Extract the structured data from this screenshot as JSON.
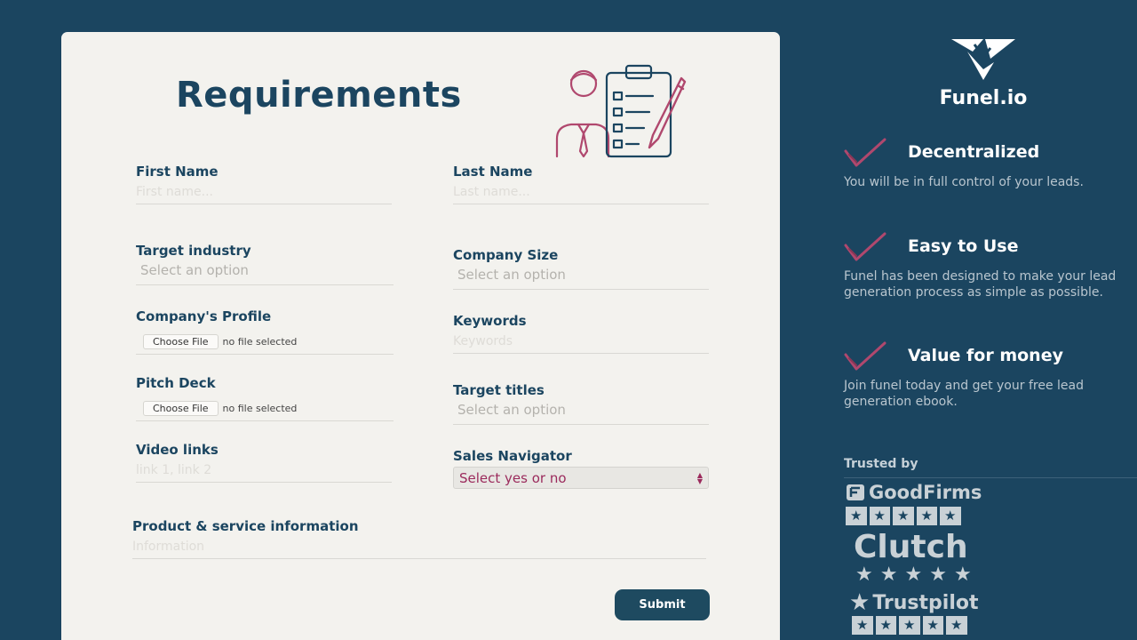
{
  "form": {
    "title": "Requirements",
    "first_name": {
      "label": "First Name",
      "placeholder": "First name..."
    },
    "last_name": {
      "label": "Last Name",
      "placeholder": "Last name..."
    },
    "target_industry": {
      "label": "Target industry",
      "value": "Select an option"
    },
    "company_size": {
      "label": "Company Size",
      "value": "Select an option"
    },
    "company_profile": {
      "label": "Company's Profile",
      "button": "Choose File",
      "status": "no file selected"
    },
    "keywords": {
      "label": "Keywords",
      "placeholder": "Keywords"
    },
    "pitch_deck": {
      "label": "Pitch Deck",
      "button": "Choose File",
      "status": "no file selected"
    },
    "target_titles": {
      "label": "Target titles",
      "value": "Select an option"
    },
    "video_links": {
      "label": "Video links",
      "placeholder": "link 1, link 2"
    },
    "sales_navigator": {
      "label": "Sales Navigator",
      "value": "Select yes or no"
    },
    "product_info": {
      "label": "Product & service information",
      "placeholder": "Information"
    },
    "submit_label": "Submit"
  },
  "sidebar": {
    "brand": "Funel.io",
    "features": [
      {
        "title": "Decentralized",
        "desc": "You will be in full control of your leads."
      },
      {
        "title": "Easy to Use",
        "desc": "Funel has been designed to make your lead generation process as simple as possible."
      },
      {
        "title": "Value for money",
        "desc": "Join funel today and get your free lead generation ebook."
      }
    ],
    "trusted_by": "Trusted by",
    "reviews": {
      "goodfirms": {
        "name": "GoodFirms",
        "rating": 5
      },
      "clutch": {
        "name": "Clutch",
        "rating": 5
      },
      "trustpilot": {
        "name": "Trustpilot",
        "rating": 5
      }
    }
  },
  "colors": {
    "background": "#1b4560",
    "card": "#f3f2ee",
    "heading": "#1b4560",
    "accent": "#9b2a5c",
    "button": "#1e4a60"
  }
}
